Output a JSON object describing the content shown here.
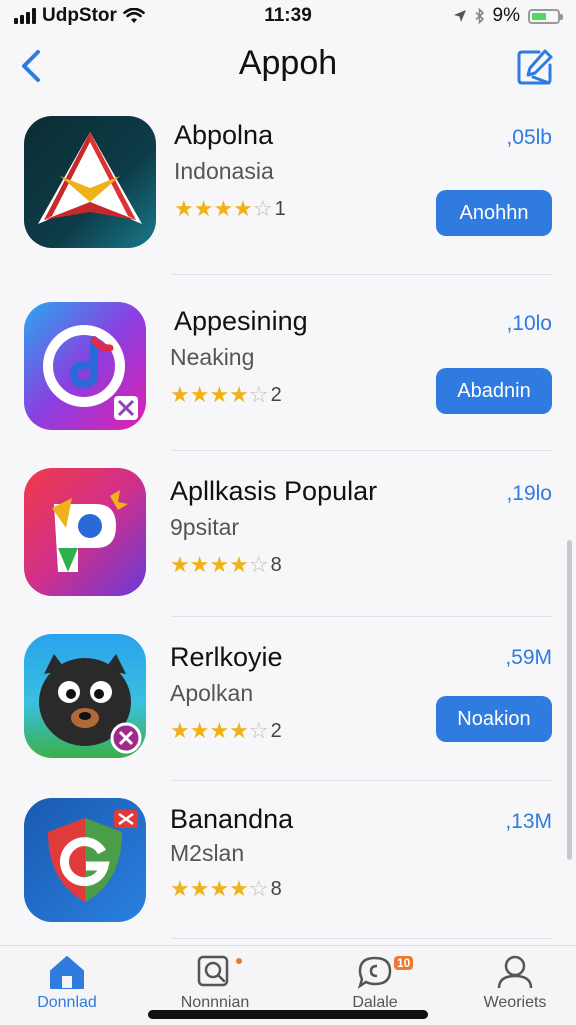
{
  "status_bar": {
    "carrier": "UdpStor",
    "time": "11:39",
    "battery": "9%",
    "battery_level": 0.6,
    "battery_color": "#4cd964"
  },
  "nav": {
    "title": "Appoh",
    "back_icon": "chevron-left-icon",
    "edit_icon": "compose-icon"
  },
  "apps": [
    {
      "name": "Abpolna",
      "subtitle": "Indonasia",
      "rating_count": "1",
      "stars": 4,
      "size": ",05lb",
      "action": "Anohhn"
    },
    {
      "name": "Appesining",
      "subtitle": "Neaking",
      "rating_count": "2",
      "stars": 4,
      "size": ",10lo",
      "action": "Abadnin"
    },
    {
      "name": "Apllkasis Popular",
      "subtitle": "9psitar",
      "rating_count": "8",
      "stars": 4,
      "size": ",19lo",
      "action": ""
    },
    {
      "name": "Rerlkoyie",
      "subtitle": "Apolkan",
      "rating_count": "2",
      "stars": 4,
      "size": ",59M",
      "action": "Noakion"
    },
    {
      "name": "Banandna",
      "subtitle": "M2slan",
      "rating_count": "8",
      "stars": 4,
      "size": ",13M",
      "action": ""
    }
  ],
  "tabs": [
    {
      "label": "Donnlad",
      "icon": "home-icon",
      "active": true
    },
    {
      "label": "Nonnnian",
      "icon": "search-icon",
      "active": false
    },
    {
      "label": "Dalale",
      "icon": "chat-icon",
      "badge": "10",
      "active": false
    },
    {
      "label": "Weoriets",
      "icon": "person-icon",
      "active": false
    }
  ],
  "colors": {
    "accent": "#2f7be0",
    "star": "#f0b21a",
    "badge": "#f0792e"
  }
}
